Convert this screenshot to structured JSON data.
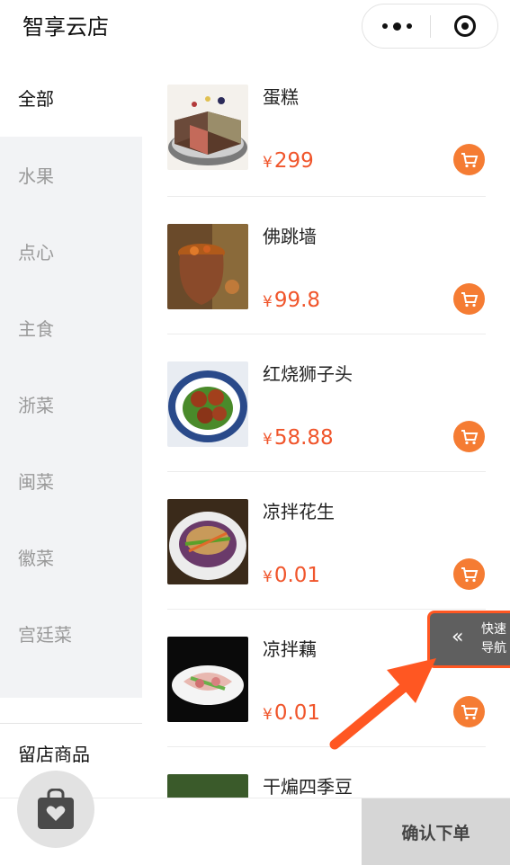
{
  "header": {
    "app_title": "智享云店",
    "more_icon": "more-dots-icon",
    "close_icon": "target-circle-icon"
  },
  "sidebar": {
    "categories": [
      {
        "label": "全部",
        "active": true
      },
      {
        "label": "水果",
        "active": false
      },
      {
        "label": "点心",
        "active": false
      },
      {
        "label": "主食",
        "active": false
      },
      {
        "label": "浙菜",
        "active": false
      },
      {
        "label": "闽菜",
        "active": false
      },
      {
        "label": "徽菜",
        "active": false
      },
      {
        "label": "宫廷菜",
        "active": false
      }
    ],
    "retained_label": "留店商品"
  },
  "products": [
    {
      "name": "蛋糕",
      "currency": "¥",
      "price": "299"
    },
    {
      "name": "佛跳墙",
      "currency": "¥",
      "price": "99.8"
    },
    {
      "name": "红烧狮子头",
      "currency": "¥",
      "price": "58.88"
    },
    {
      "name": "凉拌花生",
      "currency": "¥",
      "price": "0.01"
    },
    {
      "name": "凉拌藕",
      "currency": "¥",
      "price": "0.01"
    },
    {
      "name": "干煸四季豆",
      "currency": "",
      "price": ""
    }
  ],
  "quick_nav": {
    "label_line1": "快速",
    "label_line2": "导航",
    "chevron": "«"
  },
  "bottom_bar": {
    "bag_icon": "shopping-bag-heart-icon",
    "confirm_label": "确认下单"
  },
  "colors": {
    "price": "#f0552b",
    "cart_button": "#f57c33",
    "annotation": "#ff5722",
    "sidebar_bg": "#f2f3f5"
  }
}
